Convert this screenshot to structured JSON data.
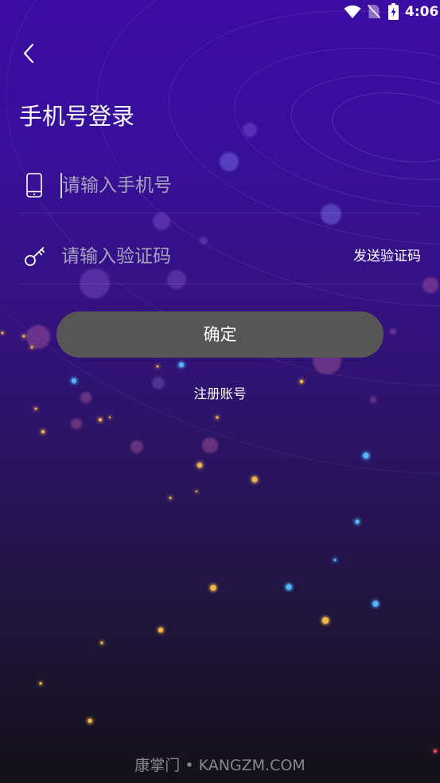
{
  "status_bar": {
    "time": "4:06",
    "icons": [
      "wifi-icon",
      "no-sim-icon",
      "battery-charging-icon"
    ]
  },
  "header": {
    "back_icon": "back-chevron-icon",
    "title": "手机号登录"
  },
  "form": {
    "phone": {
      "icon": "phone-icon",
      "placeholder": "请输入手机号",
      "value": ""
    },
    "code": {
      "icon": "key-icon",
      "placeholder": "请输入验证码",
      "value": "",
      "send_code_label": "发送验证码"
    },
    "submit_label": "确定",
    "register_label": "注册账号"
  },
  "watermark": "康掌门 • KANGZM.COM",
  "colors": {
    "background_top": "#3b0ca2",
    "background_bottom": "#131118",
    "button_background": "#565656",
    "text": "#ffffff",
    "placeholder": "#a7a2bd"
  }
}
